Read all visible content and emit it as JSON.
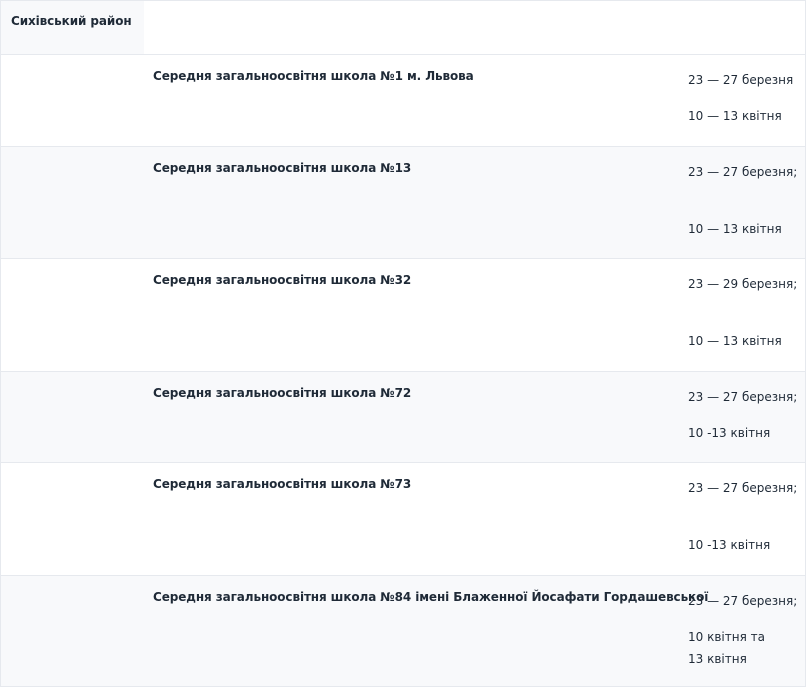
{
  "district": {
    "name": "Сихівський район"
  },
  "schools": [
    {
      "name": "Середня загальноосвітня школа №1 м. Львова",
      "dates": [
        "23 — 27 березня",
        "",
        "10 — 13 квітня"
      ]
    },
    {
      "name": "Середня загальноосвітня школа №13",
      "dates": [
        "23 — 27 березня;",
        "",
        "",
        "10 — 13 квітня"
      ]
    },
    {
      "name": "Середня загальноосвітня школа №32",
      "dates": [
        "23 — 29 березня;",
        "",
        "",
        "10 — 13 квітня"
      ]
    },
    {
      "name": "Середня загальноосвітня школа №72",
      "dates": [
        "23 — 27 березня;",
        "",
        "10 -13 квітня"
      ]
    },
    {
      "name": "Середня загальноосвітня школа №73",
      "dates": [
        "23 — 27 березня;",
        "",
        "",
        "10 -13 квітня"
      ]
    },
    {
      "name": "Середня загальноосвітня школа №84 імені Блаженної Йосафати Гордашевської",
      "dates": [
        "23 — 27 березня;",
        "",
        "10 квітня та",
        "13 квітня"
      ]
    }
  ]
}
